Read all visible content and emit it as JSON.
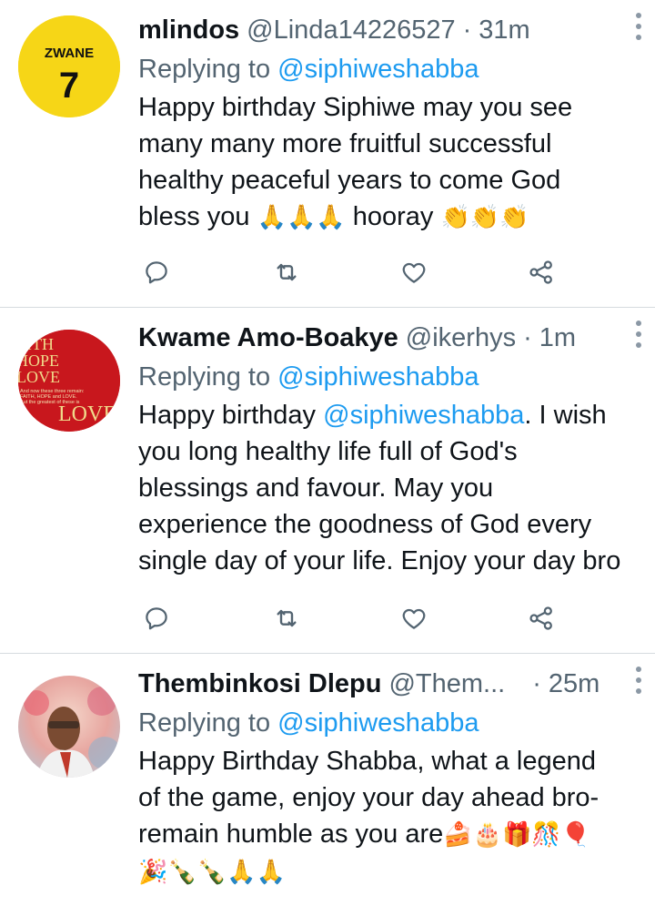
{
  "tweets": [
    {
      "display_name": "mlindos",
      "handle": "@Linda14226527",
      "separator": "·",
      "time": "31m",
      "replying_prefix": "Replying to",
      "replying_to": "@siphiweshabba",
      "text_lines": [
        "Happy birthday Siphiwe may you see",
        "many many more fruitful successful",
        "healthy peaceful years to come God"
      ],
      "last_line_text": "bless you",
      "last_line_emoji": "🙏🙏🙏",
      "last_line_tail": "hooray",
      "tail_emoji": "👏👏👏",
      "avatar": {
        "label": "ZWANE",
        "number": "7",
        "bg": "#f5d400"
      }
    },
    {
      "display_name": "Kwame Amo-Boakye",
      "handle": "@ikerhys",
      "separator": "·",
      "time": "1m",
      "replying_prefix": "Replying to",
      "replying_to": "@siphiweshabba",
      "text_first_prefix": "Happy birthday ",
      "text_first_mention": "@siphiweshabba",
      "text_first_suffix": ". I wish",
      "text_lines": [
        "you long healthy life full of God's",
        "blessings and favour. May you",
        "experience the goodness of God every",
        "single day of your life. Enjoy your day bro"
      ],
      "avatar": {
        "line1": "AITH",
        "line2": "HOPE",
        "line3": "LOVE",
        "small1": "And now these three remain:",
        "small2": "FAITH, HOPE and LOVE.",
        "small3": "But the greatest of these is",
        "big": "LOVE",
        "bg": "#c8171d"
      }
    },
    {
      "display_name": "Thembinkosi Dlepu",
      "handle": "@Them...",
      "separator": "·",
      "time": "25m",
      "replying_prefix": "Replying to",
      "replying_to": "@siphiweshabba",
      "text_lines": [
        "Happy Birthday Shabba, what a legend",
        "of the game, enjoy your day ahead bro-"
      ],
      "third_line_text": "remain humble as you are",
      "third_line_emoji": "🍰🎂🎁🎊🎈",
      "fourth_line_emoji": "🎉🍾🍾🙏🙏"
    }
  ],
  "colors": {
    "text": "#0f1419",
    "secondary": "#536471",
    "link": "#1d9bf0",
    "icon": "#536471",
    "divider": "#d6dbdf"
  },
  "icons": [
    "reply-icon",
    "retweet-icon",
    "like-icon",
    "share-icon",
    "more-icon"
  ]
}
